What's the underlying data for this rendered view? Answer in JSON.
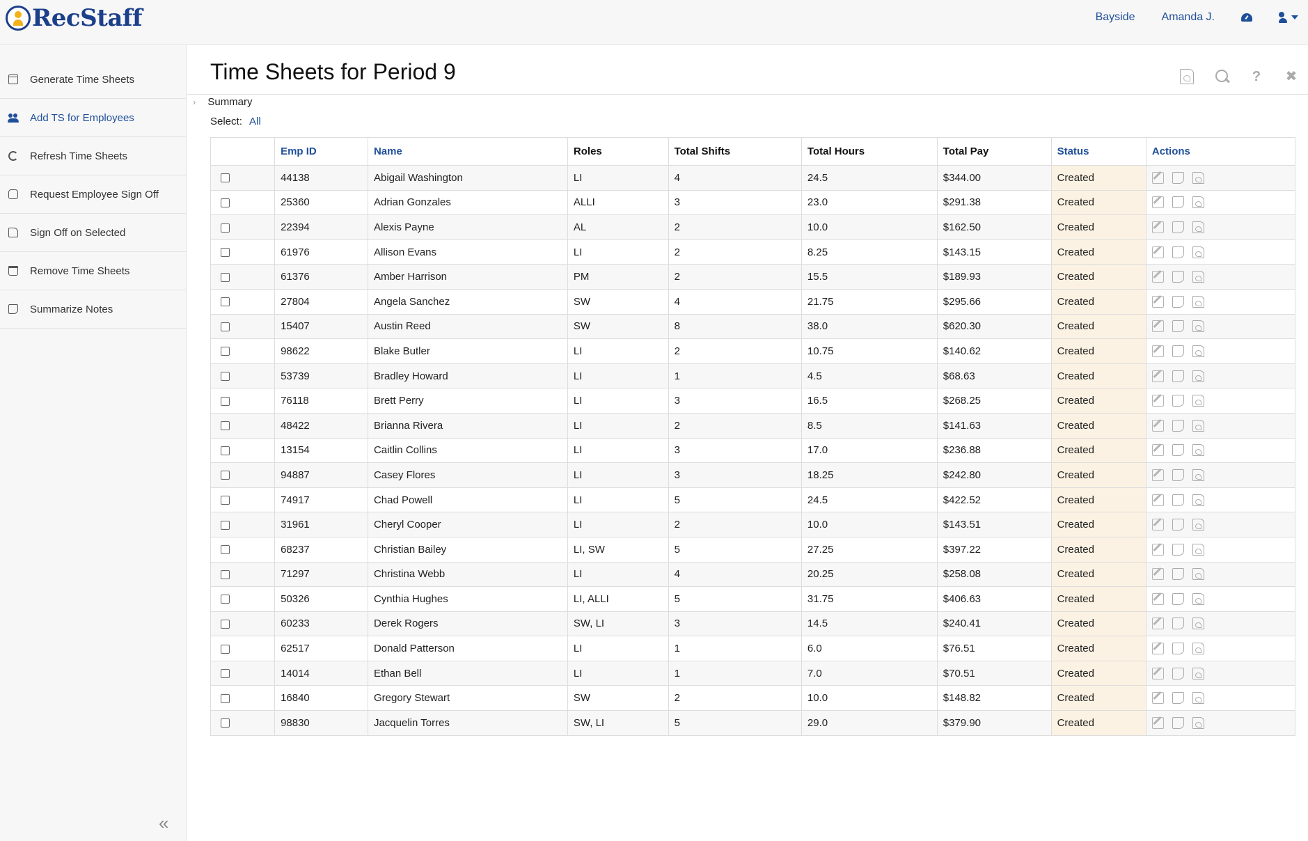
{
  "app": {
    "logo_text": "RecStaff"
  },
  "topnav": {
    "location": "Bayside",
    "user": "Amanda J."
  },
  "sidebar": {
    "items": [
      {
        "label": "Generate Time Sheets",
        "icon": "calendar-check-icon"
      },
      {
        "label": "Add TS for Employees",
        "icon": "users-icon"
      },
      {
        "label": "Refresh Time Sheets",
        "icon": "refresh-icon"
      },
      {
        "label": "Request Employee Sign Off",
        "icon": "hand-icon"
      },
      {
        "label": "Sign Off on Selected",
        "icon": "thumbs-up-icon"
      },
      {
        "label": "Remove Time Sheets",
        "icon": "trash-icon"
      },
      {
        "label": "Summarize Notes",
        "icon": "note-icon"
      }
    ],
    "collapse_glyph": "«"
  },
  "page": {
    "title": "Time Sheets for Period 9",
    "summary_label": "Summary",
    "select_label": "Select:",
    "select_all": "All",
    "help_glyph": "?",
    "close_glyph": "✖"
  },
  "table": {
    "columns": [
      "",
      "Emp ID",
      "Name",
      "Roles",
      "Total Shifts",
      "Total Hours",
      "Total Pay",
      "Status",
      "Actions"
    ],
    "rows": [
      [
        "44138",
        "Abigail Washington",
        "LI",
        "4",
        "24.5",
        "$344.00",
        "Created"
      ],
      [
        "25360",
        "Adrian Gonzales",
        "ALLI",
        "3",
        "23.0",
        "$291.38",
        "Created"
      ],
      [
        "22394",
        "Alexis Payne",
        "AL",
        "2",
        "10.0",
        "$162.50",
        "Created"
      ],
      [
        "61976",
        "Allison Evans",
        "LI",
        "2",
        "8.25",
        "$143.15",
        "Created"
      ],
      [
        "61376",
        "Amber Harrison",
        "PM",
        "2",
        "15.5",
        "$189.93",
        "Created"
      ],
      [
        "27804",
        "Angela Sanchez",
        "SW",
        "4",
        "21.75",
        "$295.66",
        "Created"
      ],
      [
        "15407",
        "Austin Reed",
        "SW",
        "8",
        "38.0",
        "$620.30",
        "Created"
      ],
      [
        "98622",
        "Blake Butler",
        "LI",
        "2",
        "10.75",
        "$140.62",
        "Created"
      ],
      [
        "53739",
        "Bradley Howard",
        "LI",
        "1",
        "4.5",
        "$68.63",
        "Created"
      ],
      [
        "76118",
        "Brett Perry",
        "LI",
        "3",
        "16.5",
        "$268.25",
        "Created"
      ],
      [
        "48422",
        "Brianna Rivera",
        "LI",
        "2",
        "8.5",
        "$141.63",
        "Created"
      ],
      [
        "13154",
        "Caitlin Collins",
        "LI",
        "3",
        "17.0",
        "$236.88",
        "Created"
      ],
      [
        "94887",
        "Casey Flores",
        "LI",
        "3",
        "18.25",
        "$242.80",
        "Created"
      ],
      [
        "74917",
        "Chad Powell",
        "LI",
        "5",
        "24.5",
        "$422.52",
        "Created"
      ],
      [
        "31961",
        "Cheryl Cooper",
        "LI",
        "2",
        "10.0",
        "$143.51",
        "Created"
      ],
      [
        "68237",
        "Christian Bailey",
        "LI, SW",
        "5",
        "27.25",
        "$397.22",
        "Created"
      ],
      [
        "71297",
        "Christina Webb",
        "LI",
        "4",
        "20.25",
        "$258.08",
        "Created"
      ],
      [
        "50326",
        "Cynthia Hughes",
        "LI, ALLI",
        "5",
        "31.75",
        "$406.63",
        "Created"
      ],
      [
        "60233",
        "Derek Rogers",
        "SW, LI",
        "3",
        "14.5",
        "$240.41",
        "Created"
      ],
      [
        "62517",
        "Donald Patterson",
        "LI",
        "1",
        "6.0",
        "$76.51",
        "Created"
      ],
      [
        "14014",
        "Ethan Bell",
        "LI",
        "1",
        "7.0",
        "$70.51",
        "Created"
      ],
      [
        "16840",
        "Gregory Stewart",
        "SW",
        "2",
        "10.0",
        "$148.82",
        "Created"
      ],
      [
        "98830",
        "Jacquelin Torres",
        "SW, LI",
        "5",
        "29.0",
        "$379.90",
        "Created"
      ]
    ]
  },
  "colors": {
    "link": "#1f4f99",
    "status_bg": "#fcf2e3",
    "stripe": "#f7f7f7"
  }
}
